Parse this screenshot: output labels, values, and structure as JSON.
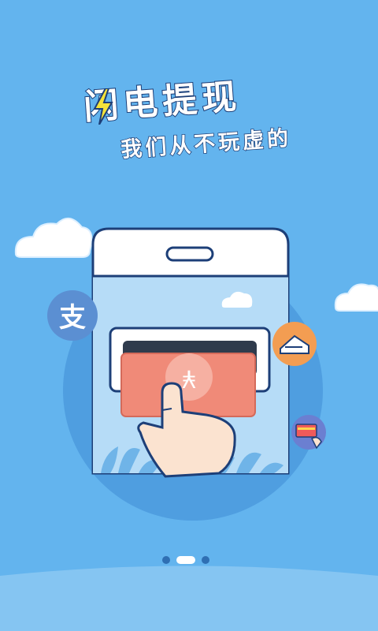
{
  "headline": {
    "title": "闪电提现",
    "subtitle": "我们从不玩虚的"
  },
  "illustration": {
    "alipay_char": "支",
    "note_char": "¥"
  },
  "pager": {
    "page_count": 3,
    "active_index": 1
  },
  "colors": {
    "background": "#63b4ee",
    "circle": "#4f9ee0",
    "phone_screen": "#b6dcf7",
    "note": "#f08a78",
    "alipay_badge": "#5b8fd2",
    "orange_badge": "#f39d52",
    "card_badge": "#6b7fd1",
    "outline": "#1d3f78"
  }
}
